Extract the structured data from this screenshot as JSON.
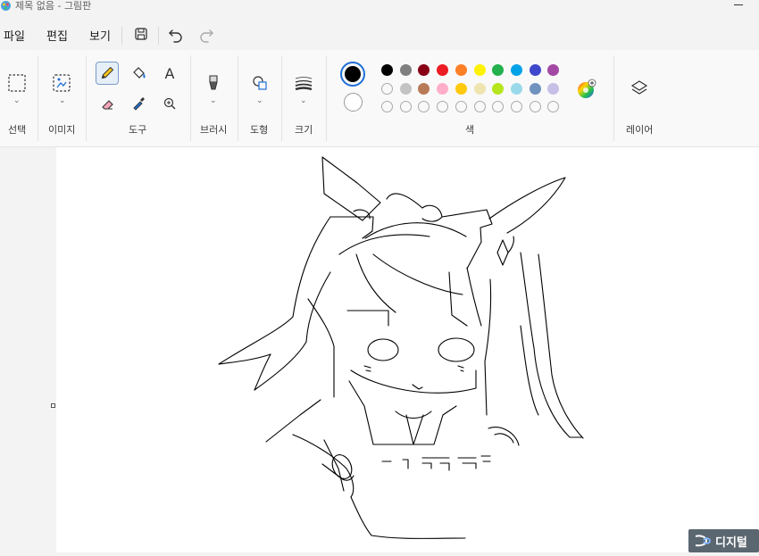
{
  "window": {
    "title": "제목 없음 - 그림판"
  },
  "menu": {
    "file": "파일",
    "edit": "편집",
    "view": "보기"
  },
  "ribbon": {
    "groups": {
      "selection": "선택",
      "image": "이미지",
      "tools": "도구",
      "brushes": "브러시",
      "shapes": "도형",
      "size": "크기",
      "colors": "색",
      "layers": "레이어"
    },
    "tools": {
      "text_glyph": "A"
    }
  },
  "colors": {
    "row1": [
      "#000000",
      "#7f7f7f",
      "#880015",
      "#ed1c24",
      "#ff7f27",
      "#fff200",
      "#22b14c",
      "#00a2e8",
      "#3f48cc",
      "#a349a4"
    ],
    "row2": [
      "#ffffff",
      "#c3c3c3",
      "#b97a57",
      "#ffaec9",
      "#ffc90e",
      "#efe4b0",
      "#b5e61d",
      "#99d9ea",
      "#7092be",
      "#c8bfe7"
    ],
    "primary": "#000000",
    "secondary": "#ffffff",
    "accent": "#1f6fd6"
  },
  "watermark": {
    "text": "디지털"
  }
}
